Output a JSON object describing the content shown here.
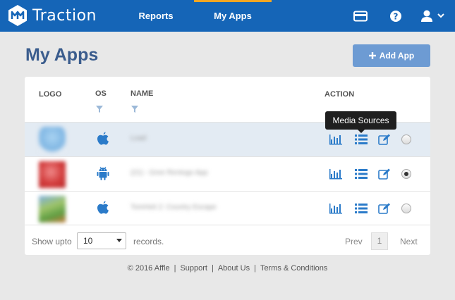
{
  "brand": {
    "name": "Traction"
  },
  "nav": {
    "reports": "Reports",
    "my_apps": "My Apps"
  },
  "page": {
    "title": "My Apps",
    "add_button": "Add App"
  },
  "table": {
    "headers": {
      "logo": "LOGO",
      "os": "OS",
      "name": "NAME",
      "action": "ACTION"
    },
    "rows": [
      {
        "os": "ios",
        "name": "Load",
        "logo_color": "#7fb6e3",
        "selected": false
      },
      {
        "os": "android",
        "name": "(21) - Gree Rentogo App",
        "logo_color": "#d23b3b",
        "selected": true
      },
      {
        "os": "ios",
        "name": "TomHeit 2: Country Escape",
        "logo_color": "#5f9e43",
        "selected": false
      }
    ],
    "tooltip": "Media Sources"
  },
  "pagination": {
    "show_label": "Show upto",
    "page_size": "10",
    "records_label": "records.",
    "prev": "Prev",
    "current_page": "1",
    "next": "Next"
  },
  "footer": {
    "copyright": "© 2016 Affle",
    "support": "Support",
    "about": "About Us",
    "terms": "Terms & Conditions"
  },
  "colors": {
    "nav_bg": "#1565b7",
    "active_tab": "#f5a623",
    "title": "#3a5c8d",
    "accent": "#2b7bc9",
    "button": "#6d9bd3"
  }
}
